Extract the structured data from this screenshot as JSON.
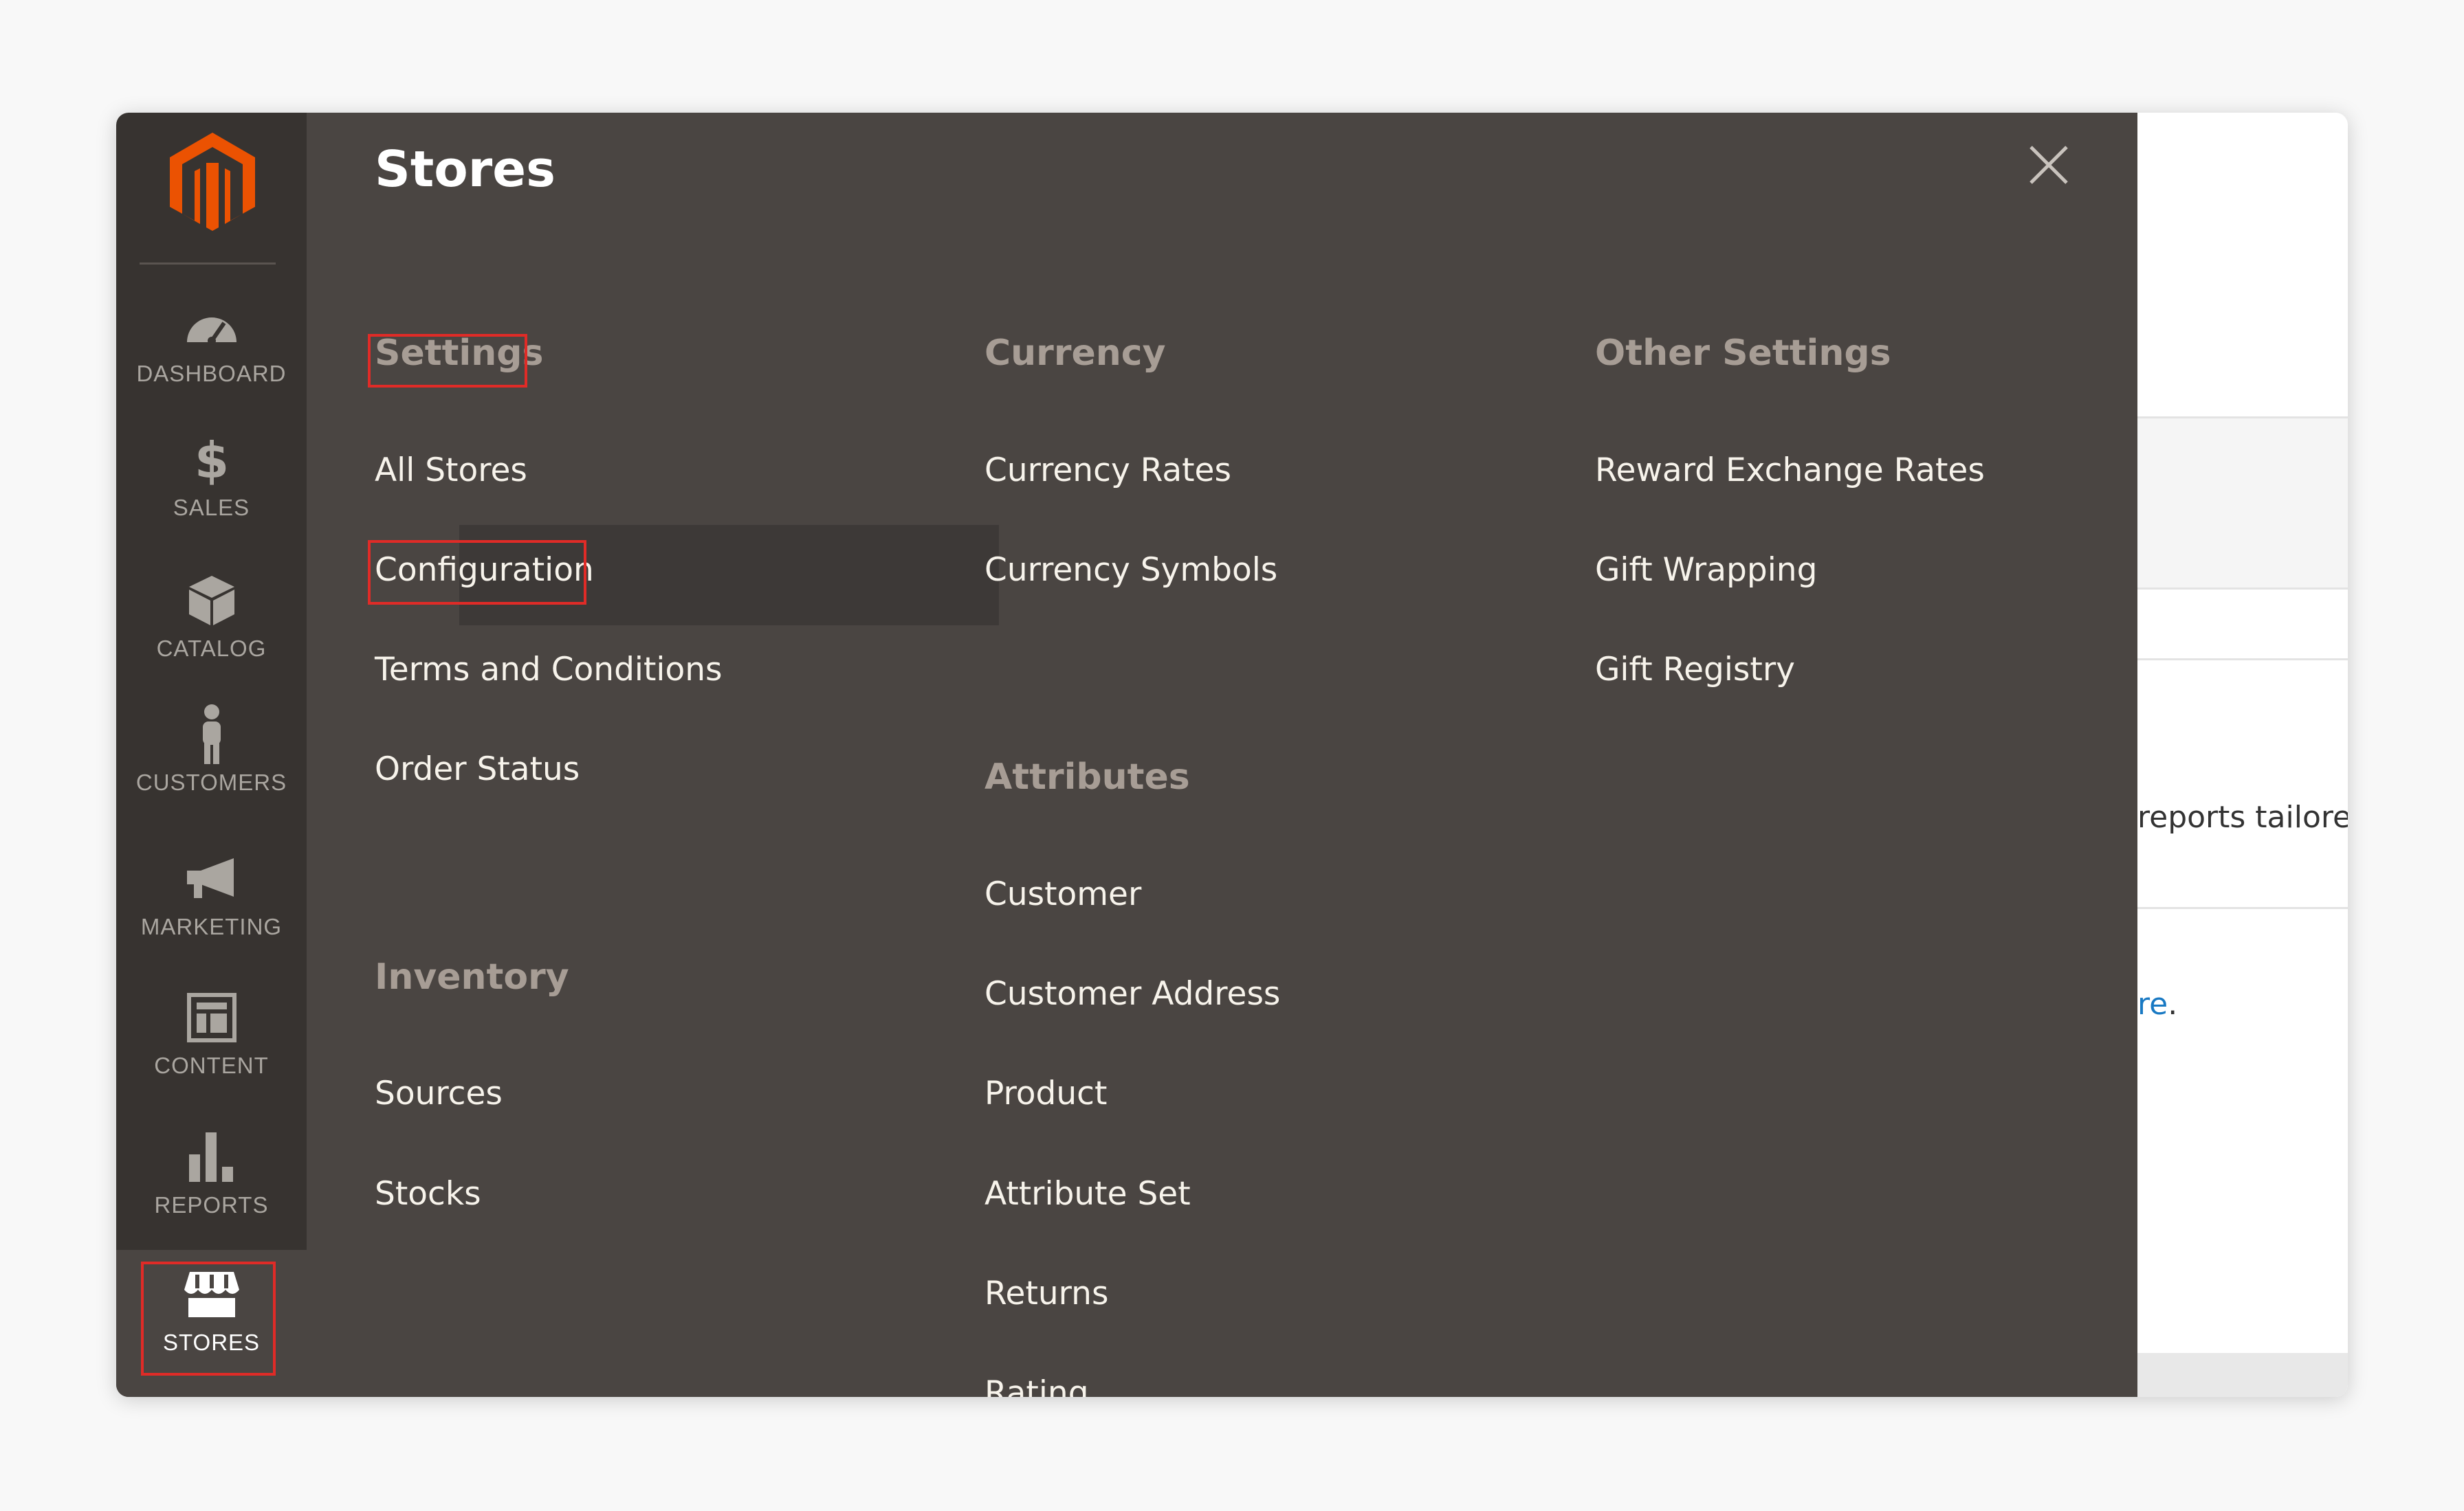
{
  "background_page": {
    "snippet_text": "reports tailore",
    "link_fragment": "re",
    "link_suffix": "."
  },
  "nav": {
    "items": [
      {
        "key": "dashboard",
        "label": "DASHBOARD",
        "icon": "speedometer-icon"
      },
      {
        "key": "sales",
        "label": "SALES",
        "icon": "dollar-icon"
      },
      {
        "key": "catalog",
        "label": "CATALOG",
        "icon": "box-icon"
      },
      {
        "key": "customers",
        "label": "CUSTOMERS",
        "icon": "person-icon"
      },
      {
        "key": "marketing",
        "label": "MARKETING",
        "icon": "megaphone-icon"
      },
      {
        "key": "content",
        "label": "CONTENT",
        "icon": "layout-icon"
      },
      {
        "key": "reports",
        "label": "REPORTS",
        "icon": "bar-chart-icon"
      },
      {
        "key": "stores",
        "label": "STORES",
        "icon": "storefront-icon"
      }
    ],
    "active": "stores"
  },
  "panel": {
    "title": "Stores",
    "groups": {
      "settings": {
        "title": "Settings",
        "items": [
          "All Stores",
          "Configuration",
          "Terms and Conditions",
          "Order Status"
        ]
      },
      "inventory": {
        "title": "Inventory",
        "items": [
          "Sources",
          "Stocks"
        ]
      },
      "currency": {
        "title": "Currency",
        "items": [
          "Currency Rates",
          "Currency Symbols"
        ]
      },
      "attributes": {
        "title": "Attributes",
        "items": [
          "Customer",
          "Customer Address",
          "Product",
          "Attribute Set",
          "Returns",
          "Rating"
        ]
      },
      "other_settings": {
        "title": "Other Settings",
        "items": [
          "Reward Exchange Rates",
          "Gift Wrapping",
          "Gift Registry"
        ]
      }
    },
    "highlighted": [
      "Settings",
      "Configuration"
    ]
  },
  "colors": {
    "nav_bg": "#373330",
    "panel_bg": "#4a4542",
    "logo_orange": "#eb5202",
    "highlight_red": "#e02b27"
  }
}
